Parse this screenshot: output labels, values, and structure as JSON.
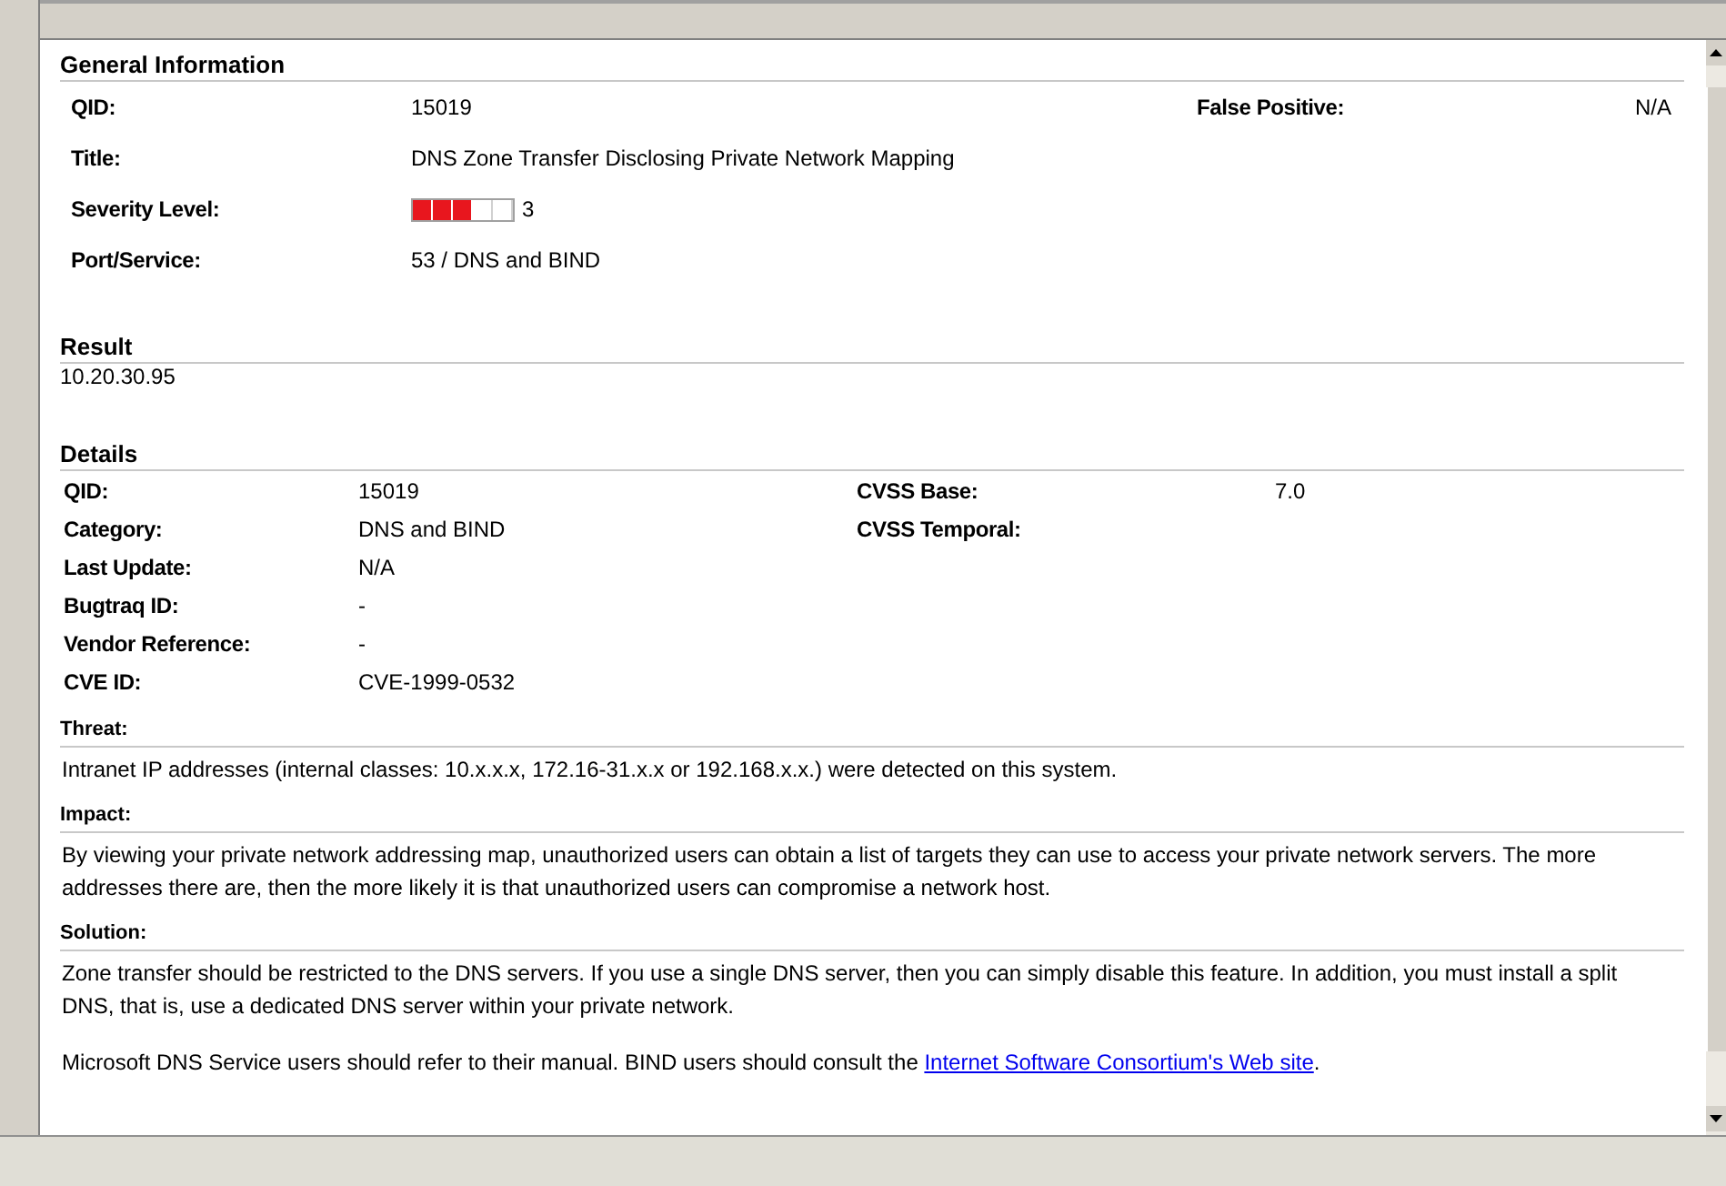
{
  "general_information": {
    "heading": "General Information",
    "rows": [
      {
        "label": "QID:",
        "value": "15019",
        "extra_label": "False Positive:",
        "extra_value": "N/A"
      },
      {
        "label": "Title:",
        "value": "DNS Zone Transfer Disclosing Private Network Mapping"
      },
      {
        "label": "Severity Level:",
        "kind": "severity",
        "level": 0.6,
        "value": "3"
      },
      {
        "label": "Port/Service:",
        "value": "53 / DNS and BIND"
      }
    ]
  },
  "result": {
    "heading": "Result",
    "value": "10.20.30.95"
  },
  "details": {
    "heading": "Details",
    "rows": [
      {
        "label": "QID:",
        "value": "15019",
        "extra_label": "CVSS Base:",
        "extra_value": "7.0"
      },
      {
        "label": "Category:",
        "value": "DNS and BIND",
        "extra_label": "CVSS Temporal:"
      },
      {
        "label": "Last Update:",
        "value": "N/A"
      },
      {
        "label": "Bugtraq ID:",
        "value": "-"
      },
      {
        "label": "Vendor Reference:",
        "value": "-"
      },
      {
        "label": "CVE ID:",
        "value": "CVE-1999-0532"
      }
    ]
  },
  "threat": {
    "heading": "Threat:",
    "paragraphs": [
      {
        "text": "Intranet IP addresses (internal classes: 10.x.x.x, 172.16-31.x.x or 192.168.x.x.) were detected on this system."
      }
    ]
  },
  "impact": {
    "heading": "Impact:",
    "paragraphs": [
      {
        "text": "By viewing your private network addressing map, unauthorized users can obtain a list of targets they can use to access your private network servers. The more addresses there are, then the more likely it is that unauthorized users can compromise a network host."
      }
    ]
  },
  "solution": {
    "heading": "Solution:",
    "paragraphs": [
      {
        "text": "Zone transfer should be restricted to the DNS servers. If you use a single DNS server, then you can simply disable this feature. In addition, you must install a split DNS, that is, use a dedicated DNS server within your private network."
      },
      {
        "text": "Microsoft DNS Service users should refer to their manual. BIND users should consult the ",
        "link": "Internet Software Consortium's Web site",
        "after": "."
      }
    ]
  }
}
